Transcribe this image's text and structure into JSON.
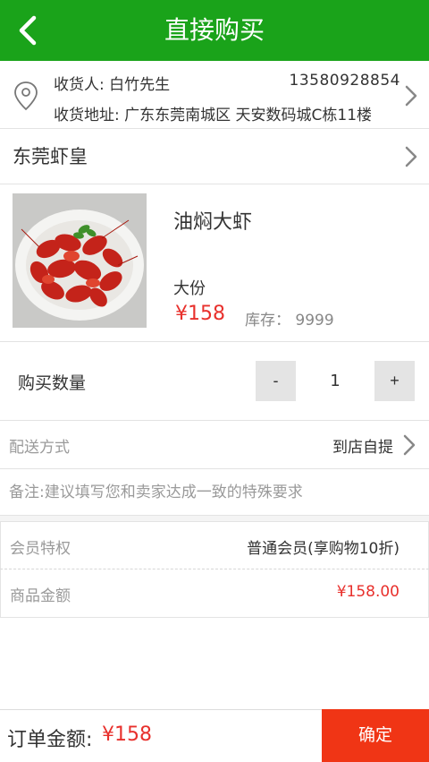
{
  "header": {
    "title": "直接购买"
  },
  "address": {
    "receiver": "收货人: 白竹先生",
    "phone": "13580928854",
    "detail": "收货地址: 广东东莞南城区 天安数码城C栋11楼"
  },
  "store": {
    "name": "东莞虾皇"
  },
  "product": {
    "name": "油焖大虾",
    "spec": "大份",
    "price": "¥158",
    "stock": "库存： 9999"
  },
  "quantity": {
    "label": "购买数量",
    "minus": "-",
    "value": "1",
    "plus": "+"
  },
  "delivery": {
    "label": "配送方式",
    "value": "到店自提"
  },
  "remark": {
    "placeholder": "备注:建议填写您和卖家达成一致的特殊要求"
  },
  "membership": {
    "label": "会员特权",
    "value": "普通会员(享购物10折)"
  },
  "goods_amount": {
    "label": "商品金额",
    "value": "¥158.00"
  },
  "footer": {
    "total_label": "订单金额:",
    "total_value": "¥158",
    "confirm_label": "确定"
  },
  "colors": {
    "header_bg": "#1aa31a",
    "price_red": "#e8302c",
    "confirm_bg": "#f03515"
  },
  "icons": [
    "back-arrow-icon",
    "location-pin-icon",
    "chevron-right-icon"
  ]
}
